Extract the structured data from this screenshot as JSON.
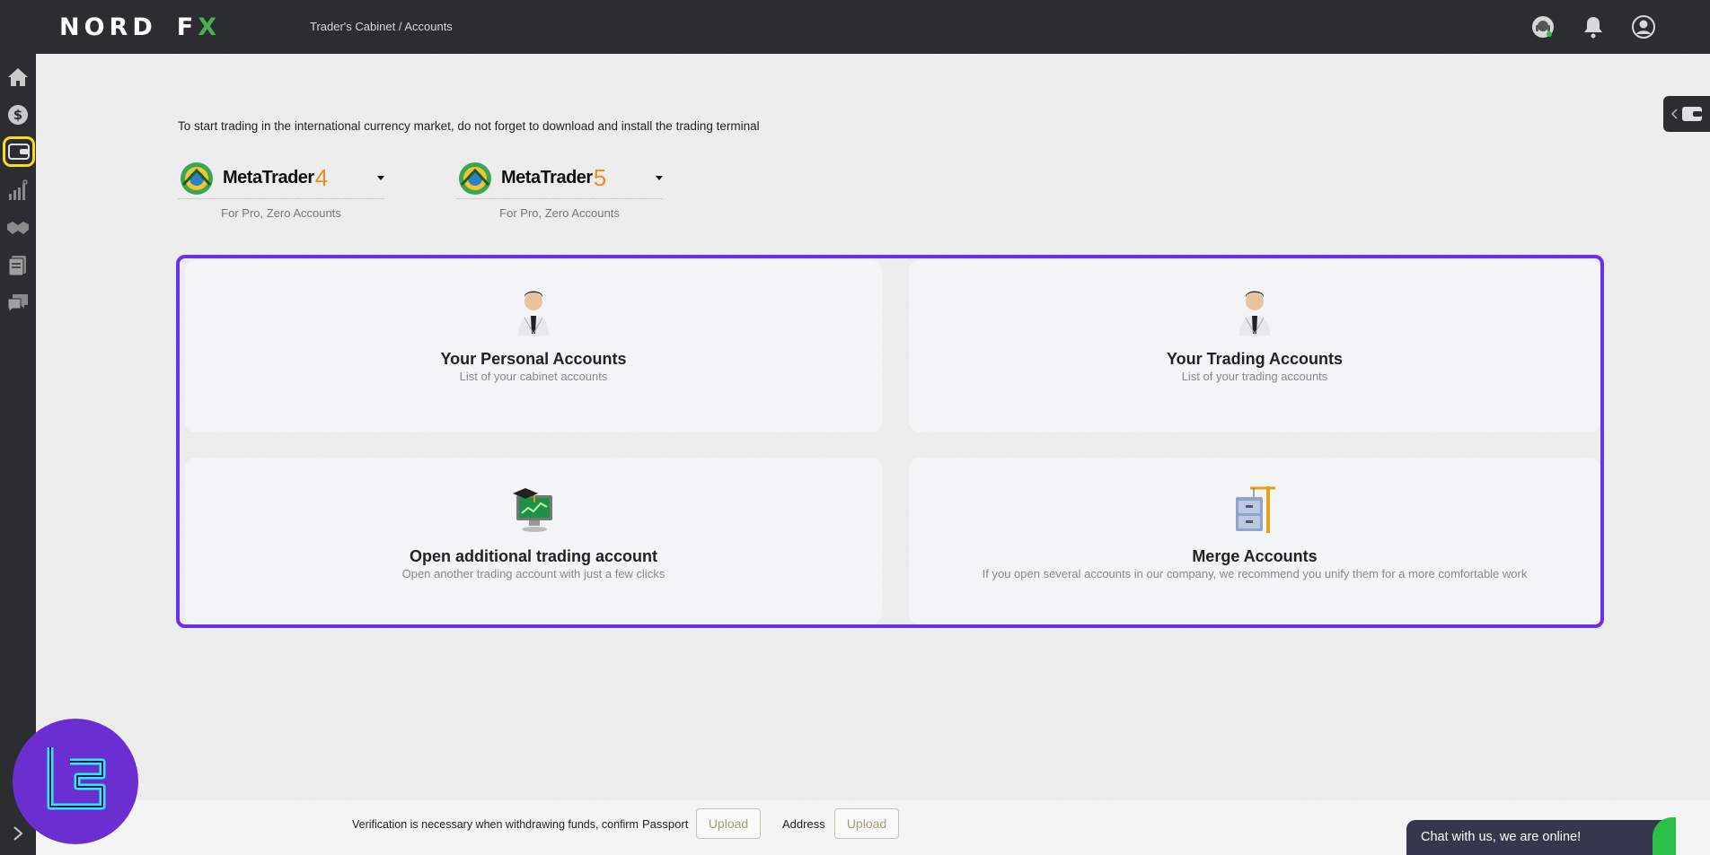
{
  "header": {
    "logo_left": "NORD",
    "logo_right_f": "F",
    "logo_right_x": "X",
    "breadcrumb": "Trader's Cabinet / Accounts"
  },
  "intro_text": "To start trading in the international currency market, do not forget to download and install the trading terminal",
  "platforms": [
    {
      "name": "MetaTrader",
      "version": "4",
      "subtitle": "For Pro, Zero Accounts"
    },
    {
      "name": "MetaTrader",
      "version": "5",
      "subtitle": "For Pro, Zero Accounts"
    }
  ],
  "cards": [
    {
      "title": "Your Personal Accounts",
      "desc": "List of your cabinet accounts",
      "icon": "person-icon"
    },
    {
      "title": "Your Trading Accounts",
      "desc": "List of your trading accounts",
      "icon": "person-icon"
    },
    {
      "title": "Open additional trading account",
      "desc": "Open another trading account with just a few clicks",
      "icon": "computer-graduation-icon"
    },
    {
      "title": "Merge Accounts",
      "desc": "If you open several accounts in our company, we recommend you unify them for a more comfortable work",
      "icon": "cabinet-crane-icon"
    }
  ],
  "verification": {
    "text": "Verification is necessary when withdrawing funds, confirm",
    "passport_label": "Passport",
    "address_label": "Address",
    "upload_label": "Upload"
  },
  "chat": {
    "label": "Chat with us, we are online!"
  },
  "colors": {
    "accent": "#6a2ff0",
    "highlight": "#f7dd1c",
    "mt_version": "#f28c1f",
    "dark": "#2b2d30"
  }
}
